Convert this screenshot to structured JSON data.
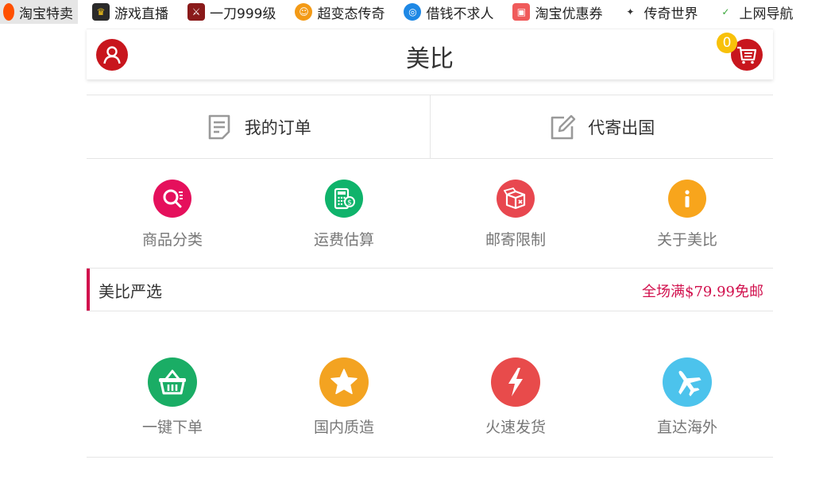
{
  "bookmarks": [
    {
      "label": "淘宝特卖",
      "icon": "taobao-icon",
      "color": "#ff5000"
    },
    {
      "label": "游戏直播",
      "icon": "game-live-icon",
      "color": "#2a2a2a"
    },
    {
      "label": "一刀999级",
      "icon": "game-icon",
      "color": "#8a1a1a"
    },
    {
      "label": "超变态传奇",
      "icon": "smile-icon",
      "color": "#f39a16"
    },
    {
      "label": "借钱不求人",
      "icon": "loan-icon",
      "color": "#1e88e5"
    },
    {
      "label": "淘宝优惠券",
      "icon": "coupon-icon",
      "color": "#f05a5a"
    },
    {
      "label": "传奇世界",
      "icon": "legend-icon",
      "color": "#555555"
    },
    {
      "label": "上网导航",
      "icon": "hao-icon",
      "color": "#3aa63a"
    }
  ],
  "header": {
    "title": "美比",
    "cart_count": "0"
  },
  "links": [
    {
      "label": "我的订单",
      "icon": "order-list-icon"
    },
    {
      "label": "代寄出国",
      "icon": "edit-icon"
    }
  ],
  "menu": [
    {
      "label": "商品分类",
      "icon": "search-category-icon",
      "color": "#e5105c"
    },
    {
      "label": "运费估算",
      "icon": "calculator-icon",
      "color": "#0fb36b"
    },
    {
      "label": "邮寄限制",
      "icon": "box-icon",
      "color": "#e8474f"
    },
    {
      "label": "关于美比",
      "icon": "info-icon",
      "color": "#f8a51c"
    }
  ],
  "section": {
    "title": "美比严选",
    "promo": "全场满$79.99免邮"
  },
  "features": [
    {
      "label": "一键下单",
      "icon": "basket-icon",
      "color": "#1aad65"
    },
    {
      "label": "国内质造",
      "icon": "star-icon",
      "color": "#f3a321"
    },
    {
      "label": "火速发货",
      "icon": "lightning-icon",
      "color": "#e84b4b"
    },
    {
      "label": "直达海外",
      "icon": "plane-icon",
      "color": "#4cc3ec"
    }
  ],
  "colors": {
    "brand_red": "#c8161d",
    "accent_pink": "#d1104d",
    "badge_yellow": "#f8c10a"
  }
}
